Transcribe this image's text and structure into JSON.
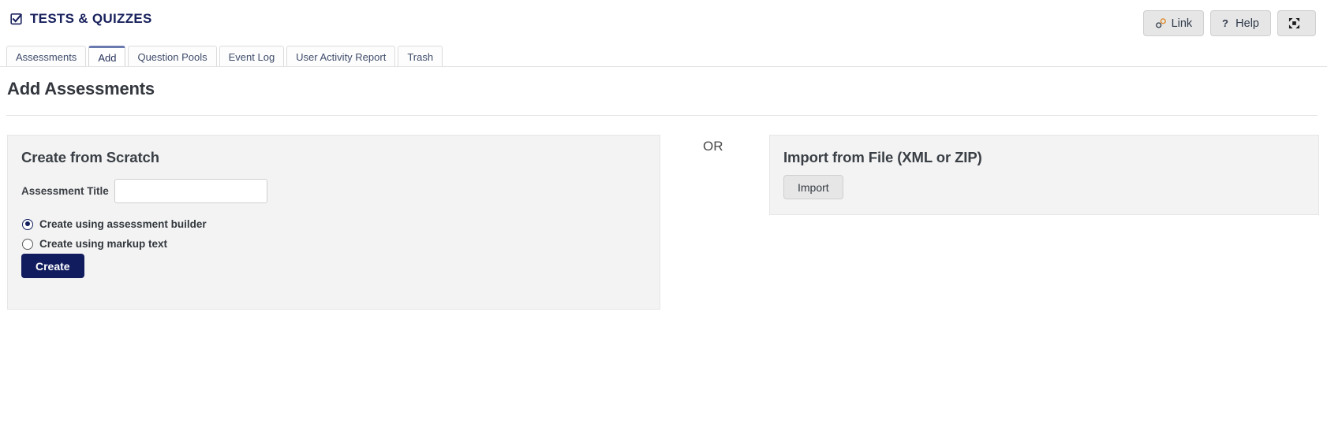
{
  "header": {
    "icon": "checked-checkbox-icon",
    "title": "TESTS & QUIZZES",
    "title_color": "#18215c",
    "buttons": [
      {
        "label": "Link",
        "icon": "chain-link-icon"
      },
      {
        "label": "Help",
        "icon": "question-mark-icon"
      },
      {
        "label": "",
        "icon": "expand-fullscreen-icon"
      }
    ]
  },
  "tabs": [
    {
      "label": "Assessments",
      "active": false
    },
    {
      "label": "Add",
      "active": true
    },
    {
      "label": "Question Pools",
      "active": false
    },
    {
      "label": "Event Log",
      "active": false
    },
    {
      "label": "User Activity Report",
      "active": false
    },
    {
      "label": "Trash",
      "active": false
    }
  ],
  "page": {
    "title": "Add Assessments"
  },
  "create_panel": {
    "heading": "Create from Scratch",
    "field_label": "Assessment Title",
    "field_value": "",
    "field_placeholder": "",
    "options": [
      {
        "label": "Create using assessment builder",
        "selected": true
      },
      {
        "label": "Create using markup text",
        "selected": false
      }
    ],
    "submit_label": "Create",
    "submit_color": "#111c5e"
  },
  "or_label": "OR",
  "import_panel": {
    "heading": "Import from File (XML or ZIP)",
    "button_label": "Import"
  }
}
